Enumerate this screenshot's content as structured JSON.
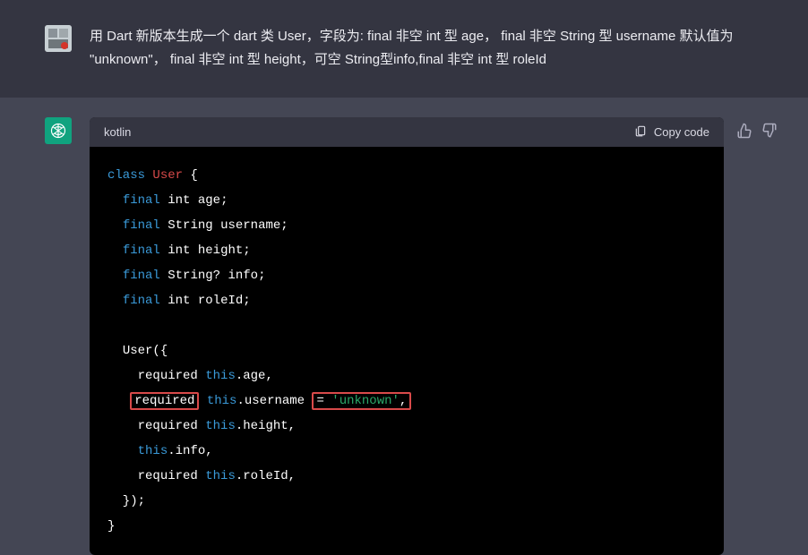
{
  "user_message": "用 Dart 新版本生成一个 dart 类 User，字段为: final 非空 int 型 age，  final 非空 String 型 username 默认值为 \"unknown\"，  final 非空 int 型 height，可空 String型info,final 非空 int 型 roleId",
  "code_block": {
    "language": "kotlin",
    "copy_label": "Copy code",
    "lines": {
      "class_kw": "class",
      "class_name": "User",
      "final_kw": "final",
      "int_type": "int",
      "string_type": "String",
      "nullable_string": "String?",
      "field_age": "age",
      "field_username": "username",
      "field_height": "height",
      "field_info": "info",
      "field_roleId": "roleId",
      "ctor_name": "User",
      "required_kw": "required",
      "this_kw": "this",
      "default_username": "'unknown'"
    }
  }
}
